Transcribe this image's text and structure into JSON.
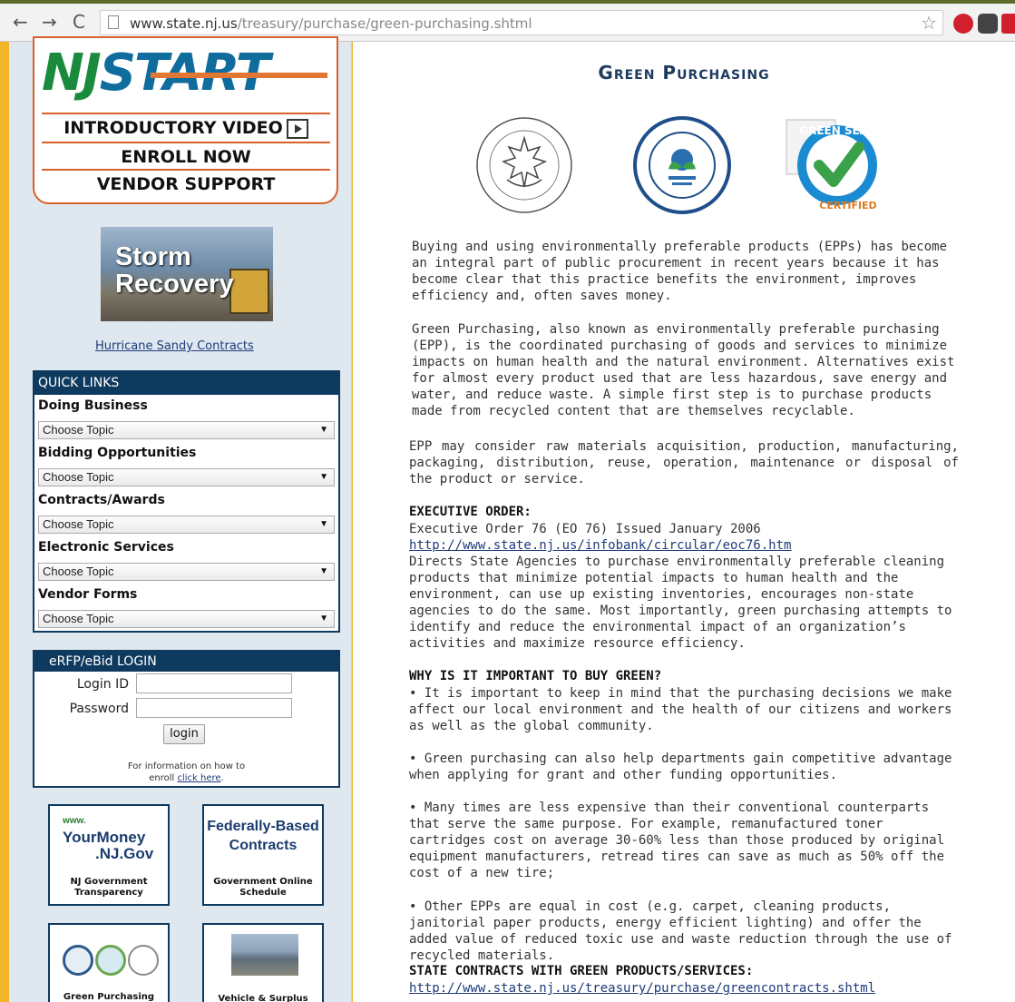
{
  "browser": {
    "url_host": "www.state.nj.us",
    "url_path": "/treasury/purchase/green-purchasing.shtml"
  },
  "sidebar": {
    "logo_nj": "NJ",
    "logo_start": "START",
    "start_links": [
      "INTRODUCTORY VIDEO",
      "ENROLL NOW",
      "VENDOR SUPPORT"
    ],
    "storm_banner": "Storm Recovery",
    "hurricane_link": "Hurricane Sandy Contracts",
    "quick_links": {
      "title": "QUICK LINKS",
      "groups": [
        {
          "label": "Doing Business",
          "select": "Choose Topic"
        },
        {
          "label": "Bidding Opportunities",
          "select": "Choose Topic"
        },
        {
          "label": "Contracts/Awards",
          "select": "Choose Topic"
        },
        {
          "label": "Electronic Services",
          "select": "Choose Topic"
        },
        {
          "label": "Vendor Forms",
          "select": "Choose Topic"
        }
      ]
    },
    "login": {
      "title": "eRFP/eBid LOGIN",
      "login_id_label": "Login ID",
      "password_label": "Password",
      "button": "login",
      "info_prefix": "For information on how to",
      "info_enroll": "enroll",
      "info_link": "click here",
      "info_suffix": "."
    },
    "badges": {
      "yourmoney": {
        "www": "www.",
        "name": "YourMoney",
        "domain": ".NJ.Gov",
        "caption": "NJ Government Transparency"
      },
      "federal": {
        "title": "Federally-Based Contracts",
        "caption": "Government Online Schedule"
      },
      "green": {
        "caption": "Green Purchasing"
      },
      "vehicle": {
        "caption": "Vehicle & Surplus"
      }
    }
  },
  "main": {
    "title": "Green Purchasing",
    "seals": [
      "environmental-choice-seal",
      "epa-seal",
      "green-seal-certified"
    ],
    "seal_green_text": "GREEN SEAL",
    "seal_green_certified": "CERTIFIED",
    "p1": "Buying and using environmentally preferable products (EPPs) has become an integral part of public procurement in recent years because it has become clear that this practice benefits the environment, improves efficiency and, often saves money.",
    "p2": "Green Purchasing, also known as environmentally preferable purchasing (EPP), is the coordinated purchasing of goods and services to minimize impacts on human health and the natural environment. Alternatives exist for almost every product used that are less hazardous, save energy and water, and reduce waste. A simple first step is to purchase products made from recycled content that are themselves recyclable.",
    "p3": "EPP may consider raw materials acquisition, production, manufacturing, packaging, distribution, reuse, operation, maintenance or disposal of the product or service.",
    "exec_heading": "EXECUTIVE ORDER:",
    "exec_line": "Executive Order 76 (EO 76) Issued January 2006",
    "exec_link": "http://www.state.nj.us/infobank/circular/eoc76.htm",
    "exec_body": "Directs State Agencies to purchase environmentally preferable cleaning products that minimize potential impacts to human health and the environment, can use up existing inventories, encourages non-state agencies to do the same. Most importantly, green purchasing attempts to identify and reduce the environmental impact of an organization’s activities and maximize resource efficiency.",
    "why_heading": "WHY IS IT IMPORTANT TO BUY GREEN?",
    "why_b1": "• It is important to keep in mind that the purchasing decisions we make affect our local environment and the health of our citizens and workers as well as the global community.",
    "why_b2": "• Green purchasing can also help departments gain competitive advantage when applying for grant and other funding opportunities.",
    "why_b3": "• Many times are less expensive than their conventional counterparts that serve the same purpose. For example, remanufactured toner cartridges cost on average 30-60% less than those produced by original equipment manufacturers, retread tires can save as much as 50% off the cost of a new tire;",
    "why_b4": "• Other EPPs are equal in cost (e.g. carpet, cleaning products, janitorial paper products, energy efficient lighting) and offer the added value of reduced toxic use and waste reduction through the use of recycled materials.",
    "contracts_heading": "STATE CONTRACTS WITH GREEN PRODUCTS/SERVICES:",
    "contracts_link": "http://www.state.nj.us/treasury/purchase/greencontracts.shtml"
  },
  "colors": {
    "navy": "#0f3a5f",
    "orange": "#d9602a",
    "sidebar_bg": "#dfe7ef",
    "frame_yellow": "#f3b62b"
  }
}
